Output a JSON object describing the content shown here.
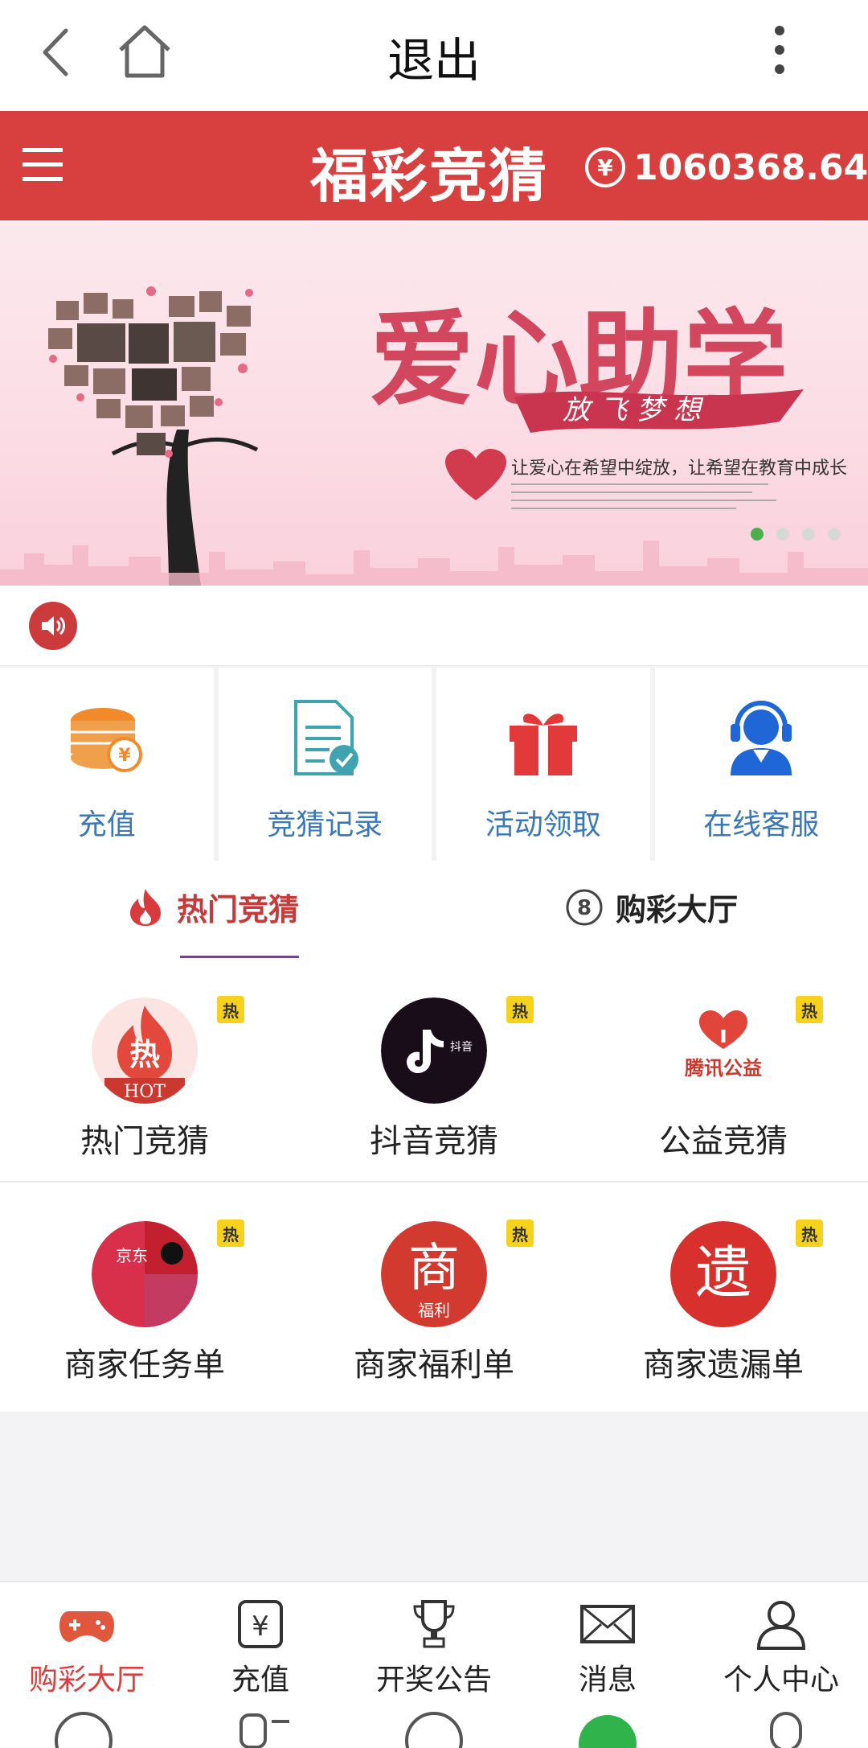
{
  "browser": {
    "title": "退出",
    "icons": [
      "back-arrow-icon",
      "home-icon",
      "more-vertical-icon"
    ]
  },
  "header": {
    "title": "福彩竞猜",
    "currency_symbol": "¥",
    "balance": "1060368.64",
    "icons": [
      "hamburger-menu-icon",
      "refresh-icon"
    ],
    "color": "#d84040"
  },
  "banner": {
    "headline": "爱心助学",
    "ribbon_text": "放飞梦想",
    "slogan": "让爱心在希望中绽放，让希望在教育中成长",
    "slide_count": 4,
    "active_slide": 1
  },
  "notice": {
    "icon": "speaker-icon"
  },
  "quick_actions": [
    {
      "label": "充值",
      "icon": "coin-stack-icon"
    },
    {
      "label": "竞猜记录",
      "icon": "document-check-icon"
    },
    {
      "label": "活动领取",
      "icon": "gift-icon"
    },
    {
      "label": "在线客服",
      "icon": "headset-agent-icon"
    }
  ],
  "tabs": [
    {
      "label": "热门竞猜",
      "icon": "flame-icon",
      "active": true
    },
    {
      "label": "购彩大厅",
      "icon": "number-8-circle-icon",
      "active": false
    }
  ],
  "games": [
    {
      "label": "热门竞猜",
      "badge": "热",
      "icon": "hot-logo",
      "logo_text": "热",
      "logo_sub": "HOT"
    },
    {
      "label": "抖音竞猜",
      "badge": "热",
      "icon": "douyin-logo",
      "logo_text": "抖音"
    },
    {
      "label": "公益竞猜",
      "badge": "热",
      "icon": "tencent-charity-logo",
      "logo_text": "腾讯公益"
    },
    {
      "label": "商家任务单",
      "badge": "热",
      "icon": "merchant-brands-logo",
      "logo_text": "京东"
    },
    {
      "label": "商家福利单",
      "badge": "热",
      "icon": "merchant-welfare-logo",
      "logo_text": "商",
      "logo_sub": "福利"
    },
    {
      "label": "商家遗漏单",
      "badge": "热",
      "icon": "merchant-missed-logo",
      "logo_text": "遗"
    }
  ],
  "bottom_nav": [
    {
      "label": "购彩大厅",
      "icon": "gamepad-icon",
      "active": true
    },
    {
      "label": "充值",
      "icon": "yen-wallet-icon",
      "active": false
    },
    {
      "label": "开奖公告",
      "icon": "trophy-icon",
      "active": false
    },
    {
      "label": "消息",
      "icon": "envelope-icon",
      "active": false
    },
    {
      "label": "个人中心",
      "icon": "user-icon",
      "active": false
    }
  ]
}
